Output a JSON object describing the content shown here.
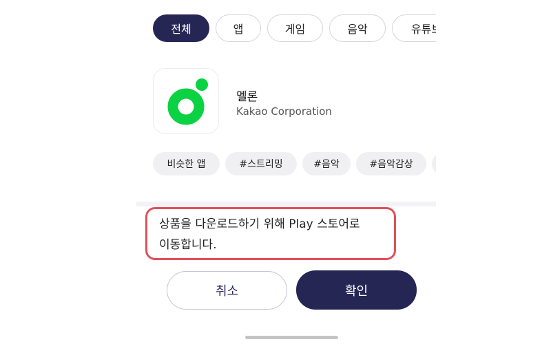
{
  "categories": {
    "items": [
      {
        "label": "전체",
        "active": true
      },
      {
        "label": "앱",
        "active": false
      },
      {
        "label": "게임",
        "active": false
      },
      {
        "label": "음악",
        "active": false
      },
      {
        "label": "유튜브",
        "active": false
      }
    ]
  },
  "app": {
    "name": "멜론",
    "developer": "Kakao Corporation",
    "icon": "melon-logo-icon",
    "icon_color": "#0ad242"
  },
  "tags": {
    "items": [
      "비슷한 앱",
      "#스트리밍",
      "#음악",
      "#음악감상",
      ""
    ]
  },
  "dialog": {
    "message_line1": "상품을 다운로드하기 위해 Play 스토어로",
    "message_line2": "이동합니다.",
    "cancel_label": "취소",
    "confirm_label": "확인"
  },
  "colors": {
    "primary": "#262655",
    "highlight_border": "#e0505a"
  }
}
